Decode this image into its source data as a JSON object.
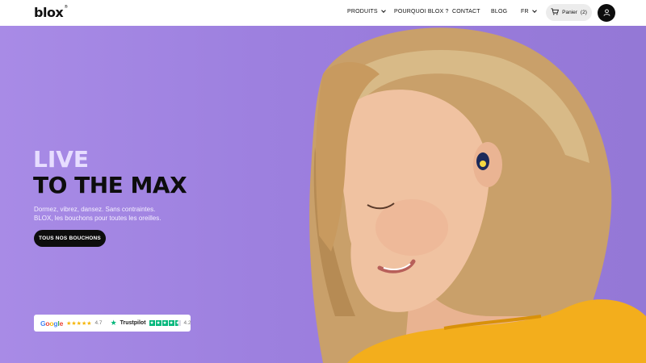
{
  "header": {
    "logo": "blox",
    "logo_mark": "®",
    "nav": [
      {
        "label": "PRODUITS",
        "has_dropdown": true
      },
      {
        "label": "POURQUOI BLOX ?",
        "has_dropdown": false
      },
      {
        "label": "CONTACT",
        "has_dropdown": false
      },
      {
        "label": "BLOG",
        "has_dropdown": false
      }
    ],
    "language": "FR",
    "cart": {
      "label": "Panier",
      "count": "(2)"
    },
    "icons": {
      "cart": "cart-icon",
      "account": "user-icon"
    }
  },
  "hero": {
    "kicker": "LIVE",
    "title": "TO THE MAX",
    "subtitle_line1": "Dormez, vibrez, dansez. Sans contraintes.",
    "subtitle_line2": "BLOX, les bouchons pour toutes les oreilles.",
    "cta": "TOUS NOS BOUCHONS"
  },
  "ratings": {
    "google": {
      "label": "Google",
      "stars": "★★★★★",
      "score": "4.7"
    },
    "trustpilot": {
      "label": "Trustpilot",
      "score": "4.2",
      "star_icon": "★"
    }
  },
  "colors": {
    "hero_bg": "#9d80df",
    "kicker": "#e7ddff",
    "text_dark": "#0d0d0d",
    "trustpilot_green": "#00b67a",
    "google_stars": "#f5b400"
  }
}
